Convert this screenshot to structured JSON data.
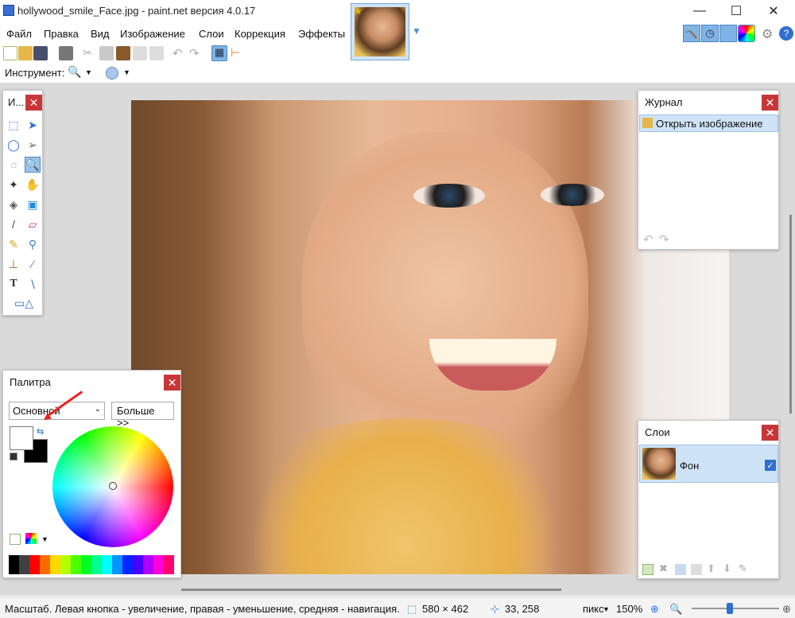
{
  "window": {
    "title": "hollywood_smile_Face.jpg - paint.net версия 4.0.17",
    "minimize": "—",
    "maximize": "☐",
    "close": "✕"
  },
  "menu": {
    "items": [
      "Файл",
      "Правка",
      "Вид",
      "Изображение",
      "Слои",
      "Коррекция",
      "Эффекты"
    ]
  },
  "toolbar": {
    "tool_label": "Инструмент:"
  },
  "tools_panel": {
    "title": "И...",
    "close": "✕"
  },
  "history_panel": {
    "title": "Журнал",
    "close": "✕",
    "entries": [
      "Открыть изображение"
    ]
  },
  "layers_panel": {
    "title": "Слои",
    "close": "✕",
    "layers": [
      {
        "name": "Фон",
        "visible": true
      }
    ]
  },
  "palette_panel": {
    "title": "Палитра",
    "close": "✕",
    "palette_select": "Основной",
    "more_button": "Больше >>",
    "primary_color": "#ffffff",
    "secondary_color": "#000000",
    "swatches": [
      "#000000",
      "#404040",
      "#ff0000",
      "#ff6a00",
      "#ffd800",
      "#b6ff00",
      "#4cff00",
      "#00ff21",
      "#00ff90",
      "#00ffff",
      "#0094ff",
      "#0026ff",
      "#4800ff",
      "#b200ff",
      "#ff00dc",
      "#ff006e"
    ]
  },
  "statusbar": {
    "hint": "Масштаб. Левая кнопка - увеличение, правая - уменьшение, средняя - навигация.",
    "image_size": "580 × 462",
    "cursor_pos": "33, 258",
    "units": "пикс",
    "zoom": "150%"
  }
}
